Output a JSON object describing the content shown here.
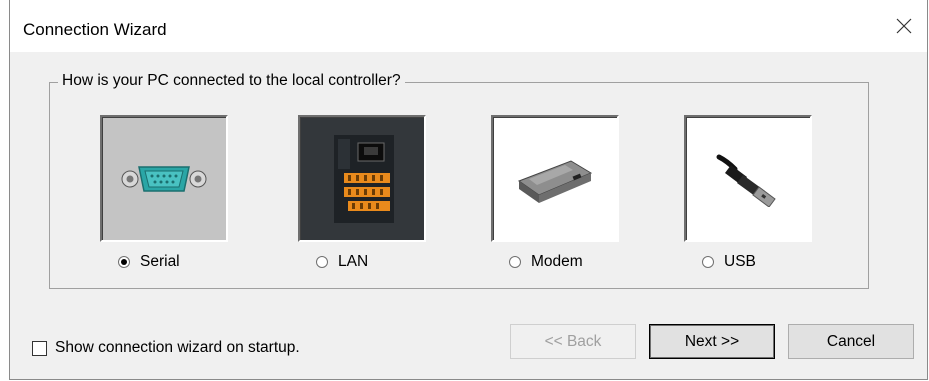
{
  "window": {
    "title": "Connection Wizard"
  },
  "group": {
    "label": "How is your PC connected to the local controller?"
  },
  "options": [
    {
      "label": "Serial",
      "selected": true,
      "icon": "serial-port-icon"
    },
    {
      "label": "LAN",
      "selected": false,
      "icon": "lan-controller-icon"
    },
    {
      "label": "Modem",
      "selected": false,
      "icon": "modem-icon"
    },
    {
      "label": "USB",
      "selected": false,
      "icon": "usb-plug-icon"
    }
  ],
  "startup_checkbox": {
    "label": "Show connection wizard on startup.",
    "checked": false
  },
  "buttons": {
    "back": "<< Back",
    "next": "Next >>",
    "cancel": "Cancel"
  },
  "colors": {
    "face": "#f0f0f0",
    "serial_plug": "#2aa6a6",
    "lan_terminal": "#e98a1c"
  }
}
